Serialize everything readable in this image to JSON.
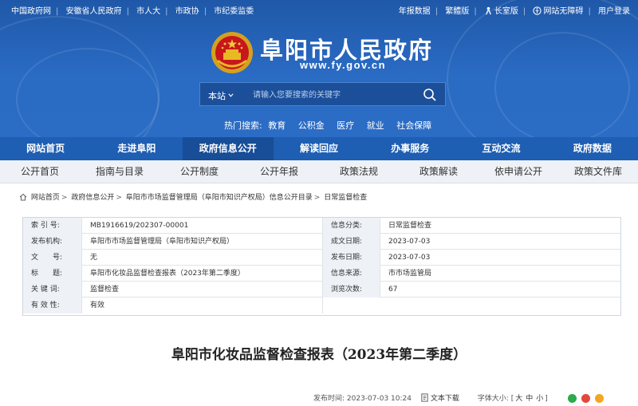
{
  "topbar": {
    "left_links": [
      "中国政府网",
      "安徽省人民政府",
      "市人大",
      "市政协",
      "市纪委监委"
    ],
    "right_links": [
      "年报数据",
      "繁體版",
      "长室版",
      "网站无障碍",
      "用户登录"
    ]
  },
  "site": {
    "title": "阜阳市人民政府",
    "url": "www.fy.gov.cn"
  },
  "search": {
    "scope": "本站",
    "placeholder": "请输入您要搜索的关键字"
  },
  "hot_search": {
    "label": "热门搜索:",
    "items": [
      "教育",
      "公积金",
      "医疗",
      "就业",
      "社会保障"
    ]
  },
  "main_nav": [
    "网站首页",
    "走进阜阳",
    "政府信息公开",
    "解读回应",
    "办事服务",
    "互动交流",
    "政府数据"
  ],
  "main_nav_active": "政府信息公开",
  "sub_nav": [
    "公开首页",
    "指南与目录",
    "公开制度",
    "公开年报",
    "政策法规",
    "政策解读",
    "依申请公开",
    "政策文件库"
  ],
  "breadcrumb": [
    "网站首页",
    "政府信息公开",
    "阜阳市市场监督管理局（阜阳市知识产权局）信息公开目录",
    "日常监督检查"
  ],
  "info": {
    "rows": [
      {
        "l1": "索 引 号:",
        "v1": "MB1916619/202307-00001",
        "l2": "信息分类:",
        "v2": "日常监督检查"
      },
      {
        "l1": "发布机构:",
        "v1": "阜阳市市场监督管理局（阜阳市知识产权局）",
        "l2": "成文日期:",
        "v2": "2023-07-03"
      },
      {
        "l1": "文　　号:",
        "v1": "无",
        "l2": "发布日期:",
        "v2": "2023-07-03"
      },
      {
        "l1": "标　　题:",
        "v1": "阜阳市化妆品监督检查报表（2023年第二季度）",
        "l2": "信息来源:",
        "v2": "市市场监管局"
      },
      {
        "l1": "关 键 词:",
        "v1": "监督检查",
        "l2": "浏览次数:",
        "v2": "67"
      },
      {
        "l1": "有 效 性:",
        "v1": "有效"
      }
    ]
  },
  "document": {
    "title": "阜阳市化妆品监督检查报表（2023年第二季度）",
    "publish_time": "发布时间: 2023-07-03 10:24",
    "download_label": "文本下载",
    "font_size_label": "字体大小:",
    "font_sizes": [
      "大",
      "中",
      "小"
    ]
  },
  "colors": {
    "header_blue": "#2a6bc4",
    "nav_blue": "#1e5eb3",
    "nav_active": "#184d97"
  }
}
